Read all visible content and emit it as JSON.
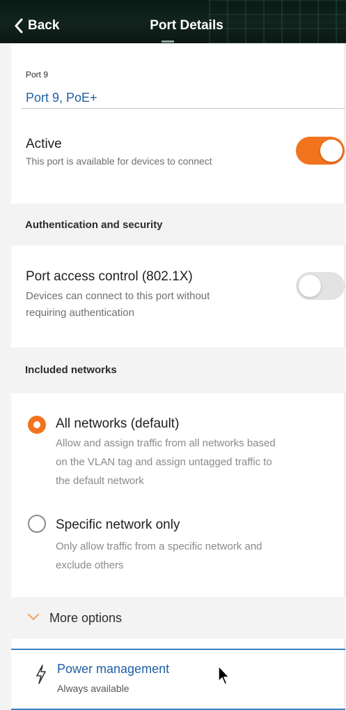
{
  "header": {
    "back_label": "Back",
    "title": "Port Details"
  },
  "port": {
    "label": "Port 9",
    "value": "Port 9, PoE+"
  },
  "active": {
    "title": "Active",
    "description": "This port is available for devices to connect",
    "enabled": true
  },
  "auth_section": {
    "title": "Authentication and security"
  },
  "port_access": {
    "title": "Port access control (802.1X)",
    "description_line1": "Devices can connect to this port without",
    "description_line2": "requiring authentication",
    "enabled": false
  },
  "networks_section": {
    "title": "Included networks"
  },
  "network_options": [
    {
      "title": "All networks (default)",
      "desc_line1": "Allow and assign traffic from all networks based",
      "desc_line2": "on the VLAN tag and assign untagged traffic to",
      "desc_line3": "the default network",
      "selected": true
    },
    {
      "title": "Specific network only",
      "desc_line1": "Only allow traffic from a specific network and",
      "desc_line2": "exclude others",
      "selected": false
    }
  ],
  "more_options": {
    "label": "More options"
  },
  "power": {
    "title": "Power management",
    "subtitle": "Always available"
  },
  "colors": {
    "accent": "#f2741e",
    "link": "#1f5fa6",
    "header_bg": "#0c1713",
    "section_bg": "#f3f3f3"
  },
  "icons": {
    "back": "chevron-left-icon",
    "more": "chevron-down-icon",
    "power": "lightning-bolt-icon",
    "cursor": "mouse-pointer-icon"
  }
}
